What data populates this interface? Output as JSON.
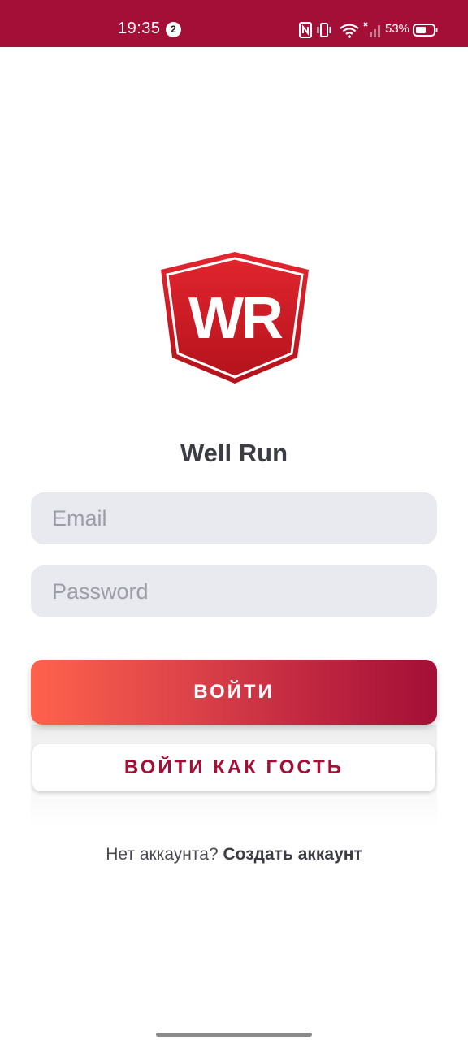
{
  "status_bar": {
    "time": "19:35",
    "notification_count": "2",
    "battery_percent": "53%",
    "icons": [
      "nfc-icon",
      "vibrate-icon",
      "wifi-icon",
      "signal-icon",
      "battery-icon"
    ]
  },
  "logo": {
    "text": "WR"
  },
  "app": {
    "title": "Well Run"
  },
  "form": {
    "email_placeholder": "Email",
    "email_value": "",
    "password_placeholder": "Password",
    "password_value": ""
  },
  "buttons": {
    "login_label": "ВОЙТИ",
    "guest_label": "ВОЙТИ КАК ГОСТЬ"
  },
  "signup": {
    "prompt": "Нет аккаунта?",
    "link_label": "Создать аккаунт"
  },
  "colors": {
    "brand": "#a30f36",
    "gradient_start": "#fe624b",
    "input_background": "#e8eaef",
    "title_text": "#3c3d44"
  }
}
